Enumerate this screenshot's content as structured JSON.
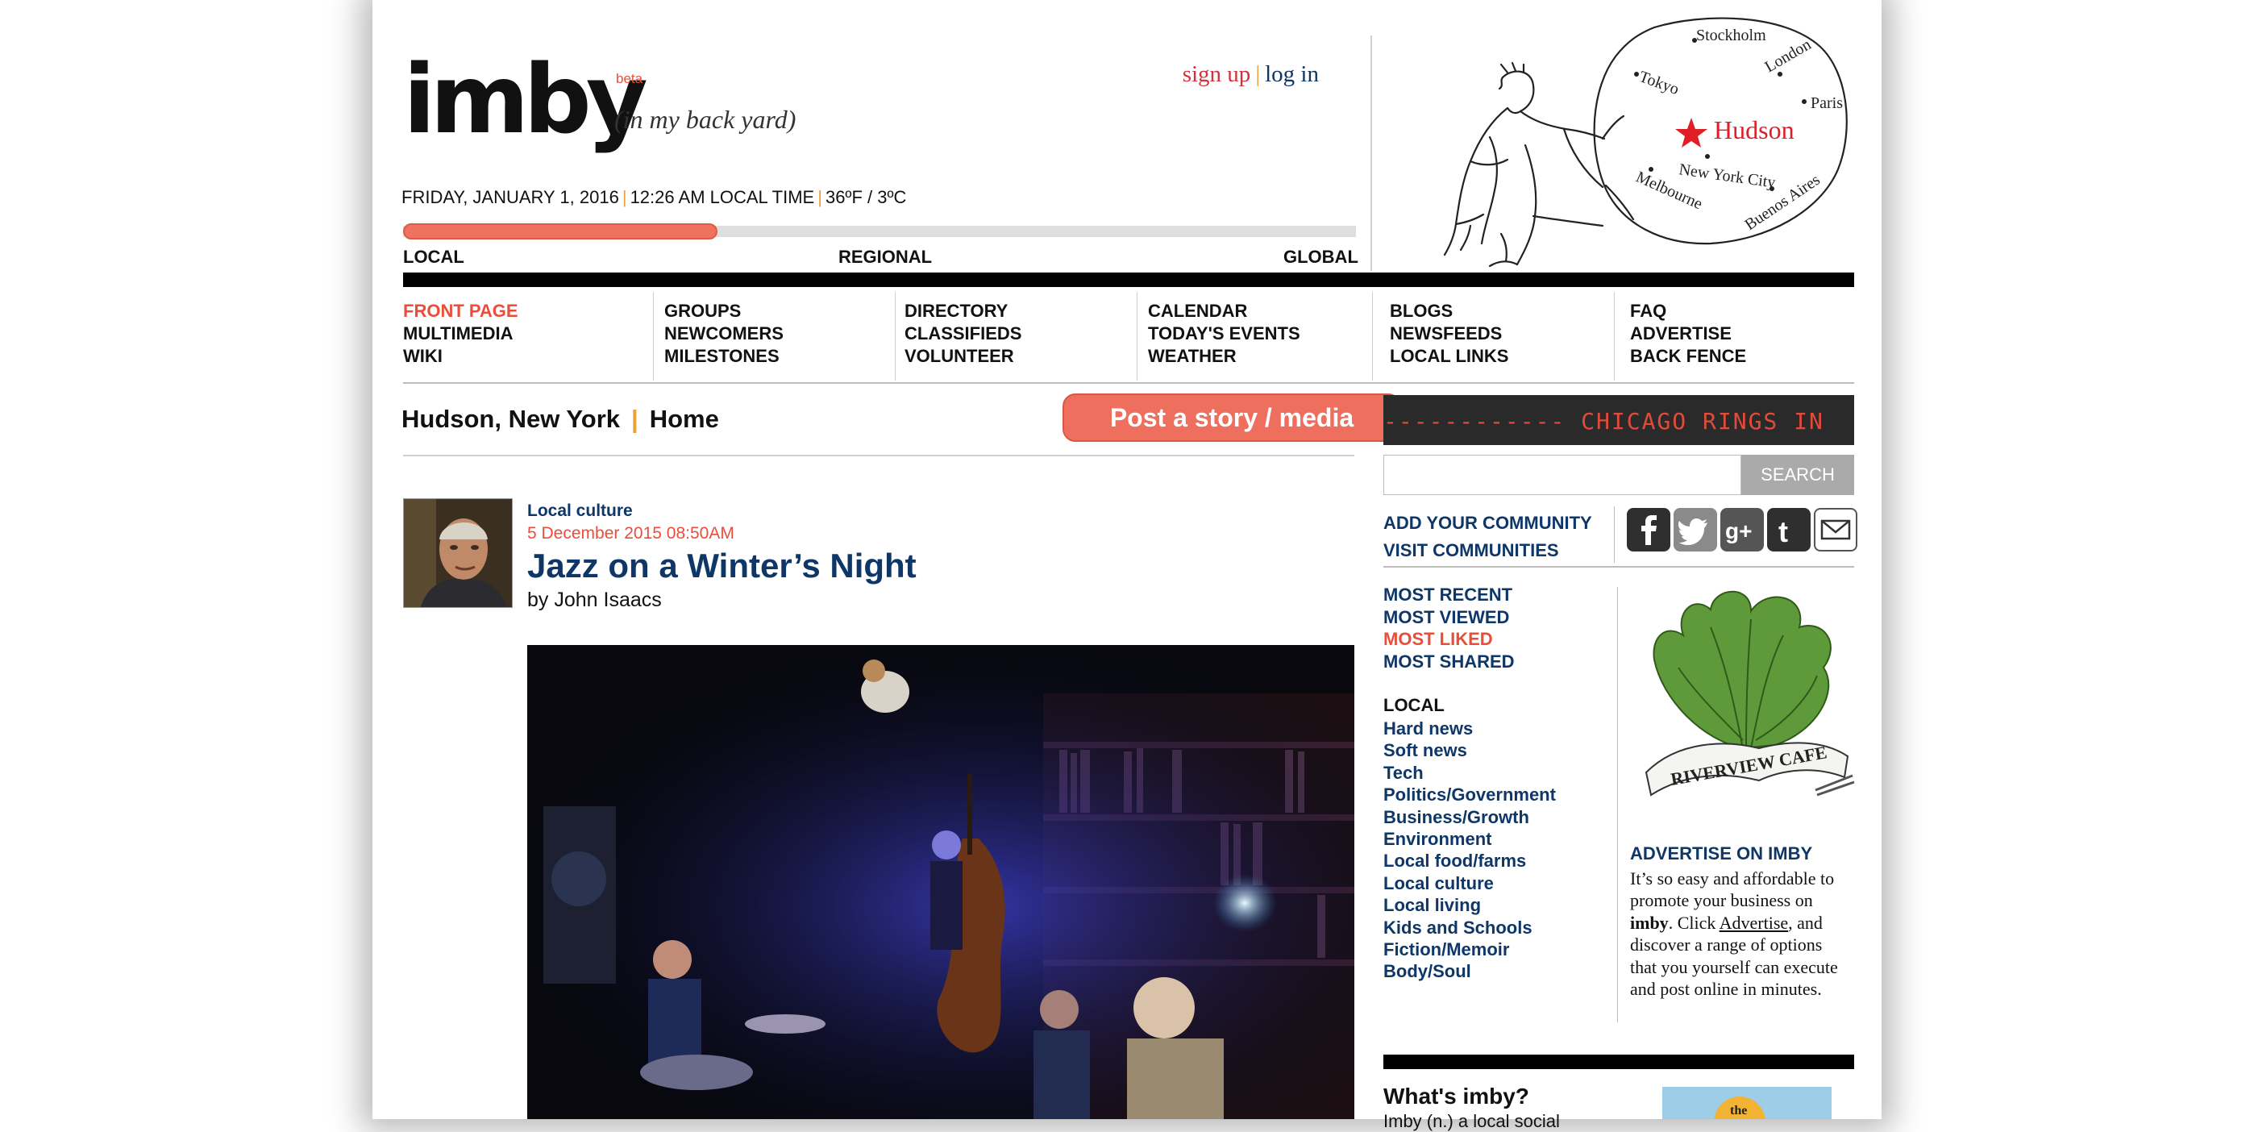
{
  "header": {
    "logo": "imby",
    "beta": "beta",
    "tagline": "(in my back yard)",
    "sign_up": "sign up",
    "auth_sep": "|",
    "log_in": "log in",
    "date": "FRIDAY, JANUARY 1, 2016",
    "time": "12:26 AM LOCAL TIME",
    "weather": "36ºF / 3ºC",
    "scale": {
      "local": "LOCAL",
      "regional": "REGIONAL",
      "global": "GLOBAL",
      "level": 0.33
    }
  },
  "map": {
    "cities": [
      "Stockholm",
      "London",
      "Tokyo",
      "Paris",
      "Hudson",
      "New York City",
      "Melbourne",
      "Buenos Aires"
    ],
    "highlight": "Hudson"
  },
  "nav": {
    "col1": [
      "FRONT PAGE",
      "MULTIMEDIA",
      "WIKI"
    ],
    "col2": [
      "GROUPS",
      "NEWCOMERS",
      "MILESTONES"
    ],
    "col3": [
      "DIRECTORY",
      "CLASSIFIEDS",
      "VOLUNTEER"
    ],
    "col4": [
      "CALENDAR",
      "TODAY'S EVENTS",
      "WEATHER"
    ],
    "col5": [
      "BLOGS",
      "NEWSFEEDS",
      "LOCAL LINKS"
    ],
    "col6": [
      "FAQ",
      "ADVERTISE",
      "BACK FENCE"
    ]
  },
  "breadcrumb": {
    "place": "Hudson, New York",
    "section": "Home"
  },
  "post_button": "Post a story / media",
  "article": {
    "category": "Local culture",
    "date": "5 December 2015 08:50AM",
    "title": "Jazz on a Winter’s Night",
    "byline": "by John Isaacs"
  },
  "sidebar": {
    "ticker": "------------  CHICAGO RINGS IN",
    "search_button": "SEARCH",
    "add_community": "ADD YOUR COMMUNITY",
    "visit_communities": "VISIT COMMUNITIES",
    "sort": [
      "MOST RECENT",
      "MOST VIEWED",
      "MOST LIKED",
      "MOST SHARED"
    ],
    "categories_heading": "LOCAL",
    "categories": [
      "Hard news",
      "Soft news",
      "Tech",
      "Politics/Government",
      "Business/Growth",
      "Environment",
      "Local food/farms",
      "Local culture",
      "Local living",
      "Kids and Schools",
      "Fiction/Memoir",
      "Body/Soul"
    ],
    "ad_logo_text": "RIVERVIEW CAFE",
    "ad_heading": "ADVERTISE ON IMBY",
    "ad_text_1": "It’s so easy and affordable to promote your business on ",
    "ad_text_brand": "imby",
    "ad_text_2": ". Click ",
    "ad_text_link": "Advertise",
    "ad_text_3": ", and discover a range of options that you yourself can execute and post online in minutes.",
    "whats_heading": "What's imby?",
    "whats_sub": "Imby (n.) a local social",
    "badge_text": "the"
  },
  "colors": {
    "accent": "#e94e3b",
    "navy": "#0e3768",
    "orange": "#e9a23b"
  }
}
